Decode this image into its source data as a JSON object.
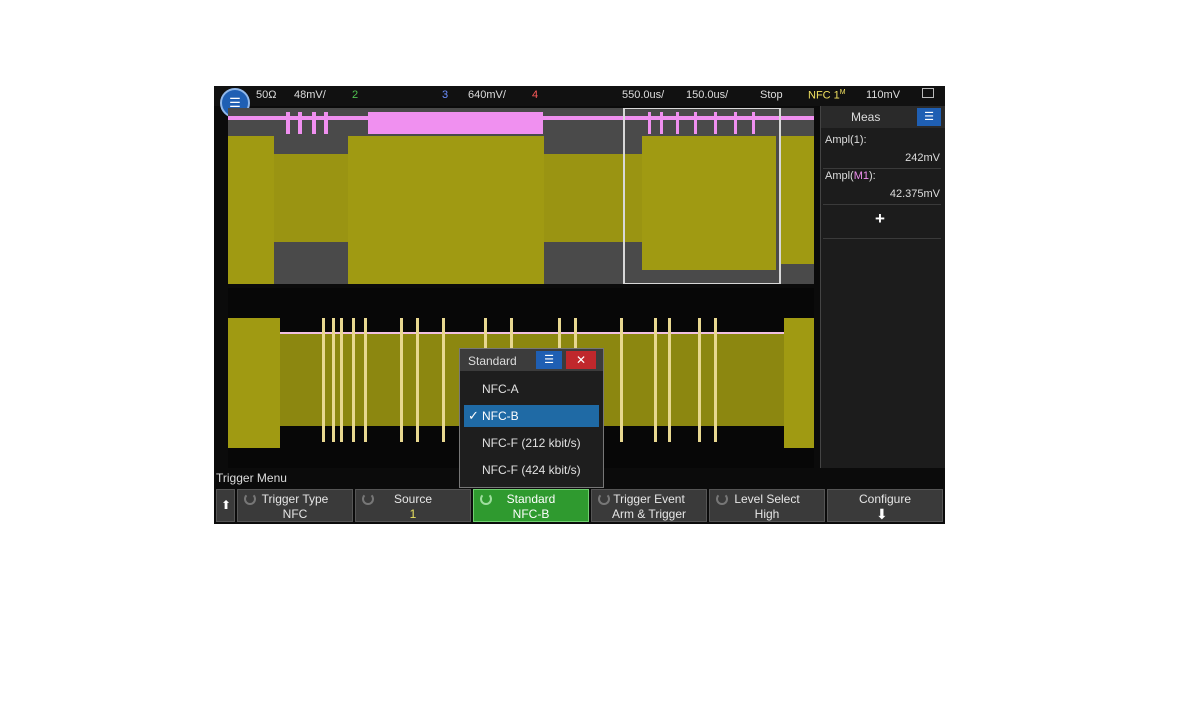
{
  "status_bar": {
    "ch1_impedance": "50Ω",
    "ch1_scale": "48mV/",
    "ch2_label": "2",
    "ch3_label": "3",
    "ch3_scale": "640mV/",
    "ch4_label": "4",
    "timebase": "550.0us/",
    "delay": "150.0us/",
    "run_state": "Stop",
    "trigger_type": "NFC 1",
    "trigger_superscript": "M",
    "trigger_level": "110mV"
  },
  "measurements": {
    "title": "Meas",
    "items": [
      {
        "label": "Ampl(1):",
        "value": "242mV"
      },
      {
        "label_prefix": "Ampl(",
        "label_channel": "M1",
        "label_suffix": "):",
        "value": "42.375mV"
      }
    ],
    "add_label": "+"
  },
  "popup": {
    "title": "Standard",
    "close_label": "✕",
    "options": [
      "NFC-A",
      "NFC-B",
      "NFC-F (212 kbit/s)",
      "NFC-F (424 kbit/s)"
    ],
    "selected_index": 1
  },
  "menu": {
    "title": "Trigger Menu",
    "softkeys": [
      {
        "title": "Trigger Type",
        "value": "NFC"
      },
      {
        "title": "Source",
        "value": "1"
      },
      {
        "title": "Standard",
        "value": "NFC-B"
      },
      {
        "title": "Trigger Event",
        "value": "Arm & Trigger"
      },
      {
        "title": "Level Select",
        "value": "High"
      },
      {
        "title": "Configure",
        "value": ""
      }
    ],
    "active_softkey_index": 2
  },
  "colors": {
    "ch1_trace": "#a09a12",
    "math_trace": "#f090f0",
    "accent": "#1f5fb3",
    "active_softkey": "#2f9a2f"
  }
}
